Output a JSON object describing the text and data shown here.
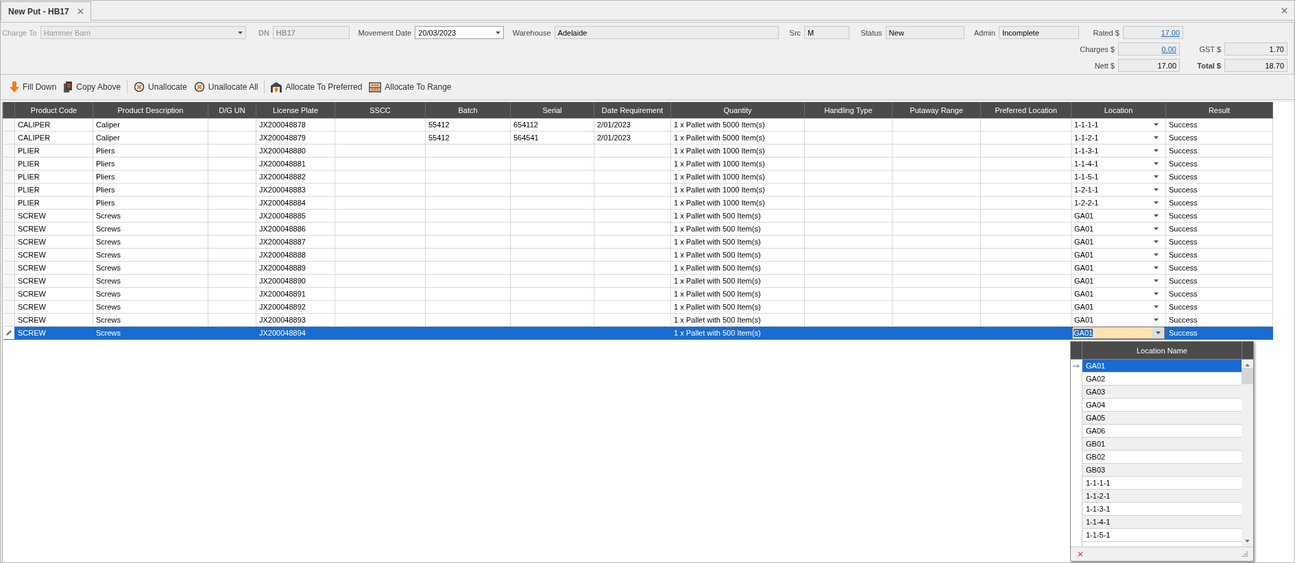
{
  "tab": {
    "title": "New Put - HB17",
    "selected": true
  },
  "header": {
    "rows": [
      [
        {
          "label": "Charge To",
          "value": "Hammer Barn",
          "kind": "combo",
          "disabled": true
        },
        {
          "label": "DN",
          "value": "HB17",
          "kind": "field",
          "disabled": true,
          "bold": true
        },
        {
          "label": "Movement Date",
          "value": "20/03/2023",
          "kind": "date",
          "disabled": false
        },
        {
          "label": "Warehouse",
          "value": "Adelaide",
          "kind": "field",
          "disabled": false
        },
        {
          "label": "Src",
          "value": "M",
          "kind": "field",
          "disabled": false
        },
        {
          "label": "Status",
          "value": "New",
          "kind": "field",
          "disabled": false
        },
        {
          "label": "Admin",
          "value": "Incomplete",
          "kind": "field",
          "disabled": false
        },
        {
          "label": "Rated $",
          "value": "17.00",
          "kind": "link",
          "disabled": false
        }
      ],
      [
        {
          "label": "Charges $",
          "value": "0.00",
          "kind": "link",
          "disabled": false
        },
        {
          "label": "GST $",
          "value": "1.70",
          "kind": "amount",
          "disabled": false
        }
      ],
      [
        {
          "label": "Nett $",
          "value": "17.00",
          "kind": "amount",
          "disabled": false
        },
        {
          "label": "Total $",
          "value": "18.70",
          "kind": "amount",
          "disabled": false,
          "bold": true
        }
      ]
    ]
  },
  "toolbar": [
    [
      "Fill Down",
      "Copy Above"
    ],
    [
      "Unallocate",
      "Unallocate All"
    ],
    [
      "Allocate To Preferred",
      "Allocate To Range"
    ]
  ],
  "table": {
    "columns": [
      "Product Code",
      "Product Description",
      "D/G UN",
      "License Plate",
      "SSCC",
      "Batch",
      "Serial",
      "Date Requirement",
      "Quantity",
      "Handling Type",
      "Putaway Range",
      "Preferred Location",
      "Location",
      "Result"
    ],
    "rows": [
      {
        "product_code": "CALIPER",
        "product_description": "Caliper",
        "license_plate": "JX200048878",
        "batch": "55412",
        "serial": "654112",
        "date_requirement": "2/01/2023",
        "quantity": "1 x Pallet with 5000 Item(s)",
        "location": "1-1-1-1",
        "result": "Success",
        "selected": false
      },
      {
        "product_code": "CALIPER",
        "product_description": "Caliper",
        "license_plate": "JX200048879",
        "batch": "55412",
        "serial": "564541",
        "date_requirement": "2/01/2023",
        "quantity": "1 x Pallet with 5000 Item(s)",
        "location": "1-1-2-1",
        "result": "Success",
        "selected": false
      },
      {
        "product_code": "PLIER",
        "product_description": "Pliers",
        "license_plate": "JX200048880",
        "quantity": "1 x Pallet with 1000 Item(s)",
        "location": "1-1-3-1",
        "result": "Success",
        "selected": false
      },
      {
        "product_code": "PLIER",
        "product_description": "Pliers",
        "license_plate": "JX200048881",
        "quantity": "1 x Pallet with 1000 Item(s)",
        "location": "1-1-4-1",
        "result": "Success",
        "selected": false
      },
      {
        "product_code": "PLIER",
        "product_description": "Pliers",
        "license_plate": "JX200048882",
        "quantity": "1 x Pallet with 1000 Item(s)",
        "location": "1-1-5-1",
        "result": "Success",
        "selected": false
      },
      {
        "product_code": "PLIER",
        "product_description": "Pliers",
        "license_plate": "JX200048883",
        "quantity": "1 x Pallet with 1000 Item(s)",
        "location": "1-2-1-1",
        "result": "Success",
        "selected": false
      },
      {
        "product_code": "PLIER",
        "product_description": "Pliers",
        "license_plate": "JX200048884",
        "quantity": "1 x Pallet with 1000 Item(s)",
        "location": "1-2-2-1",
        "result": "Success",
        "selected": false
      },
      {
        "product_code": "SCREW",
        "product_description": "Screws",
        "license_plate": "JX200048885",
        "quantity": "1 x Pallet with 500 Item(s)",
        "location": "GA01",
        "result": "Success",
        "selected": false
      },
      {
        "product_code": "SCREW",
        "product_description": "Screws",
        "license_plate": "JX200048886",
        "quantity": "1 x Pallet with 500 Item(s)",
        "location": "GA01",
        "result": "Success",
        "selected": false
      },
      {
        "product_code": "SCREW",
        "product_description": "Screws",
        "license_plate": "JX200048887",
        "quantity": "1 x Pallet with 500 Item(s)",
        "location": "GA01",
        "result": "Success",
        "selected": false
      },
      {
        "product_code": "SCREW",
        "product_description": "Screws",
        "license_plate": "JX200048888",
        "quantity": "1 x Pallet with 500 Item(s)",
        "location": "GA01",
        "result": "Success",
        "selected": false
      },
      {
        "product_code": "SCREW",
        "product_description": "Screws",
        "license_plate": "JX200048889",
        "quantity": "1 x Pallet with 500 Item(s)",
        "location": "GA01",
        "result": "Success",
        "selected": false
      },
      {
        "product_code": "SCREW",
        "product_description": "Screws",
        "license_plate": "JX200048890",
        "quantity": "1 x Pallet with 500 Item(s)",
        "location": "GA01",
        "result": "Success",
        "selected": false
      },
      {
        "product_code": "SCREW",
        "product_description": "Screws",
        "license_plate": "JX200048891",
        "quantity": "1 x Pallet with 500 Item(s)",
        "location": "GA01",
        "result": "Success",
        "selected": false
      },
      {
        "product_code": "SCREW",
        "product_description": "Screws",
        "license_plate": "JX200048892",
        "quantity": "1 x Pallet with 500 Item(s)",
        "location": "GA01",
        "result": "Success",
        "selected": false
      },
      {
        "product_code": "SCREW",
        "product_description": "Screws",
        "license_plate": "JX200048893",
        "quantity": "1 x Pallet with 500 Item(s)",
        "location": "GA01",
        "result": "Success",
        "selected": false
      },
      {
        "product_code": "SCREW",
        "product_description": "Screws",
        "license_plate": "JX200048894",
        "quantity": "1 x Pallet with 500 Item(s)",
        "location": "GA01",
        "result": "Success",
        "selected": true
      }
    ]
  },
  "location_dropdown": {
    "header": "Location Name",
    "items": [
      {
        "label": "GA01",
        "selected": true
      },
      {
        "label": "GA02",
        "selected": false
      },
      {
        "label": "GA03",
        "selected": false
      },
      {
        "label": "GA04",
        "selected": false
      },
      {
        "label": "GA05",
        "selected": false
      },
      {
        "label": "GA06",
        "selected": false
      },
      {
        "label": "GB01",
        "selected": false
      },
      {
        "label": "GB02",
        "selected": false
      },
      {
        "label": "GB03",
        "selected": false
      },
      {
        "label": "1-1-1-1",
        "selected": false
      },
      {
        "label": "1-1-2-1",
        "selected": false
      },
      {
        "label": "1-1-3-1",
        "selected": false
      },
      {
        "label": "1-1-4-1",
        "selected": false
      },
      {
        "label": "1-1-5-1",
        "selected": false
      }
    ]
  }
}
